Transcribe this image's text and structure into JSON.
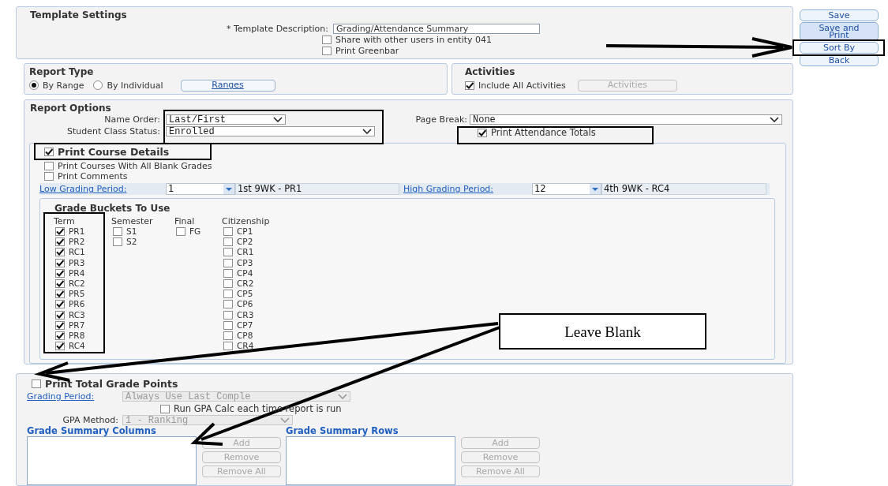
{
  "template_settings": {
    "title": "Template Settings",
    "description": {
      "label": "* Template Description:",
      "value": "Grading/Attendance Summary"
    },
    "checkboxes": [
      {
        "label": "Share with other users in entity 041",
        "checked": false
      },
      {
        "label": "Print Greenbar",
        "checked": false
      }
    ]
  },
  "report_type": {
    "title": "Report Type",
    "options": [
      {
        "label": "By Range",
        "selected": true
      },
      {
        "label": "By Individual",
        "selected": false
      }
    ],
    "button": {
      "label": "Ranges",
      "disabled": false
    }
  },
  "activities": {
    "title": "Activities",
    "checkbox": {
      "label": "Include All Activities",
      "checked": true
    },
    "button": {
      "label": "Activities",
      "disabled": true
    }
  },
  "report_options": {
    "title": "Report Options",
    "name_order": {
      "label": "Name Order:",
      "value": "Last/First"
    },
    "student_class_status": {
      "label": "Student Class Status:",
      "value": "Enrolled"
    },
    "page_break": {
      "label": "Page Break:",
      "value": "None"
    },
    "print_attendance_totals": {
      "label": "Print Attendance Totals",
      "checked": true
    },
    "print_course_details": {
      "label": "Print Course Details",
      "checked": true
    },
    "checkboxes": [
      {
        "label": "Print Courses With All Blank Grades",
        "checked": false
      },
      {
        "label": "Print Comments",
        "checked": false
      }
    ],
    "grading_periods": [
      {
        "label": "Low Grading Period:",
        "value": "1",
        "description": "1st 9WK - PR1"
      },
      {
        "label": "High Grading Period:",
        "value": "12",
        "description": "4th 9WK - RC4"
      }
    ],
    "grade_buckets": {
      "title": "Grade Buckets To Use",
      "columns": [
        {
          "heading": "Term",
          "items": [
            {
              "label": "PR1",
              "checked": true
            },
            {
              "label": "PR2",
              "checked": true
            },
            {
              "label": "RC1",
              "checked": true
            },
            {
              "label": "PR3",
              "checked": true
            },
            {
              "label": "PR4",
              "checked": true
            },
            {
              "label": "RC2",
              "checked": true
            },
            {
              "label": "PR5",
              "checked": true
            },
            {
              "label": "PR6",
              "checked": true
            },
            {
              "label": "RC3",
              "checked": true
            },
            {
              "label": "PR7",
              "checked": true
            },
            {
              "label": "PR8",
              "checked": true
            },
            {
              "label": "RC4",
              "checked": true
            }
          ]
        },
        {
          "heading": "Semester",
          "items": [
            {
              "label": "S1",
              "checked": false
            },
            {
              "label": "S2",
              "checked": false
            }
          ]
        },
        {
          "heading": "Final",
          "items": [
            {
              "label": "FG",
              "checked": false
            }
          ]
        },
        {
          "heading": "Citizenship",
          "items": [
            {
              "label": "CP1",
              "checked": false
            },
            {
              "label": "CP2",
              "checked": false
            },
            {
              "label": "CR1",
              "checked": false
            },
            {
              "label": "CP3",
              "checked": false
            },
            {
              "label": "CP4",
              "checked": false
            },
            {
              "label": "CR2",
              "checked": false
            },
            {
              "label": "CP5",
              "checked": false
            },
            {
              "label": "CP6",
              "checked": false
            },
            {
              "label": "CR3",
              "checked": false
            },
            {
              "label": "CP7",
              "checked": false
            },
            {
              "label": "CP8",
              "checked": false
            },
            {
              "label": "CR4",
              "checked": false
            }
          ]
        }
      ]
    }
  },
  "grade_points": {
    "print_total": {
      "label": "Print Total Grade Points",
      "checked": false
    },
    "grading_period": {
      "label": "Grading Period:",
      "value": "Always Use Last Comple",
      "disabled": true
    },
    "run_gpa": {
      "label": "Run GPA Calc each time report is run",
      "checked": false
    },
    "gpa_method": {
      "label": "GPA Method:",
      "value": "1 - Ranking",
      "disabled": true
    },
    "lists": [
      {
        "title": "Grade Summary Columns",
        "buttons": [
          {
            "label": "Add",
            "disabled": true
          },
          {
            "label": "Remove",
            "disabled": true
          },
          {
            "label": "Remove All",
            "disabled": true
          }
        ]
      },
      {
        "title": "Grade Summary Rows",
        "buttons": [
          {
            "label": "Add",
            "disabled": true
          },
          {
            "label": "Remove",
            "disabled": true
          },
          {
            "label": "Remove All",
            "disabled": true
          }
        ]
      }
    ]
  },
  "actions": [
    {
      "label": "Save",
      "default": false
    },
    {
      "label": "Save and Print",
      "default": true
    },
    {
      "label": "Sort By",
      "default": false
    },
    {
      "label": "Back",
      "default": false
    }
  ],
  "callout": "Leave Blank"
}
